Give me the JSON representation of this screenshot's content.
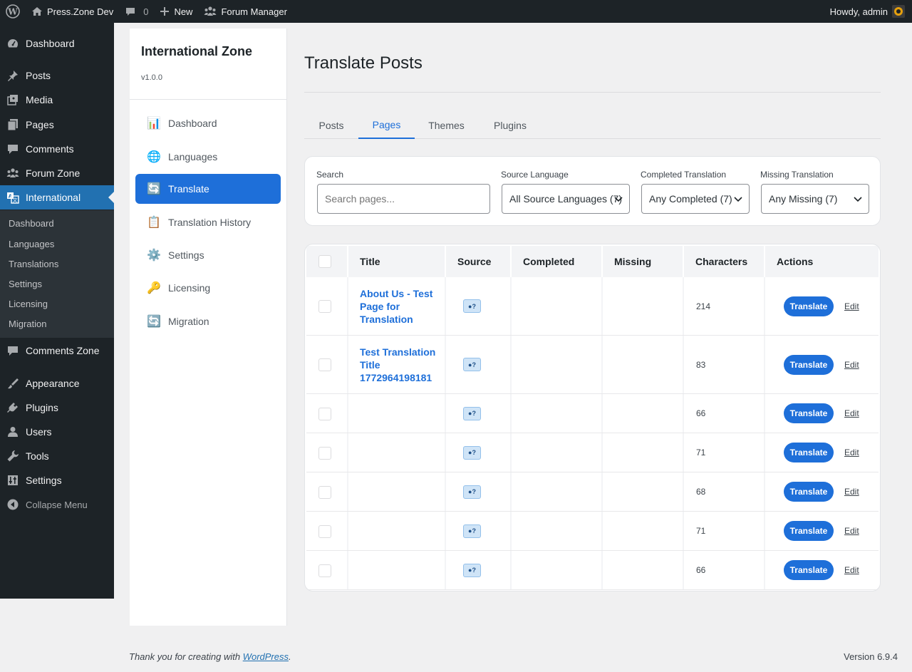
{
  "adminbar": {
    "site_name": "Press.Zone Dev",
    "comments_count": "0",
    "new_label": "New",
    "forum_label": "Forum Manager",
    "howdy": "Howdy, admin"
  },
  "menu": {
    "items": [
      "Dashboard",
      "Posts",
      "Media",
      "Pages",
      "Comments",
      "Forum Zone",
      "International",
      "Comments Zone",
      "Appearance",
      "Plugins",
      "Users",
      "Tools",
      "Settings",
      "Collapse Menu"
    ],
    "submenu": [
      "Dashboard",
      "Languages",
      "Translations",
      "Settings",
      "Licensing",
      "Migration"
    ]
  },
  "plugin": {
    "name": "International Zone",
    "version": "v1.0.0",
    "nav": [
      {
        "icon": "📊",
        "label": "Dashboard"
      },
      {
        "icon": "🌐",
        "label": "Languages"
      },
      {
        "icon": "🔄",
        "label": "Translate"
      },
      {
        "icon": "📋",
        "label": "Translation History"
      },
      {
        "icon": "⚙️",
        "label": "Settings"
      },
      {
        "icon": "🔑",
        "label": "Licensing"
      },
      {
        "icon": "🔄",
        "label": "Migration"
      }
    ]
  },
  "main": {
    "title": "Translate Posts",
    "tabs": [
      "Posts",
      "Pages",
      "Themes",
      "Plugins"
    ],
    "active_tab": "Pages",
    "filters": {
      "search_label": "Search",
      "search_placeholder": "Search pages...",
      "source_label": "Source Language",
      "source_value": "All Source Languages (7)",
      "completed_label": "Completed Translation",
      "completed_value": "Any Completed (7)",
      "missing_label": "Missing Translation",
      "missing_value": "Any Missing (7)"
    },
    "table": {
      "columns": [
        "Title",
        "Source",
        "Completed",
        "Missing",
        "Characters",
        "Actions"
      ],
      "source_badge": "●?",
      "translate_label": "Translate",
      "edit_label": "Edit",
      "rows": [
        {
          "title": "About Us - Test Page for Translation",
          "completed": "",
          "missing": "",
          "characters": "214"
        },
        {
          "title": "Test Translation Title 1772964198181",
          "completed": "",
          "missing": "",
          "characters": "83"
        },
        {
          "title": "",
          "completed": "",
          "missing": "",
          "characters": "66"
        },
        {
          "title": "",
          "completed": "",
          "missing": "",
          "characters": "71"
        },
        {
          "title": "",
          "completed": "",
          "missing": "",
          "characters": "68"
        },
        {
          "title": "",
          "completed": "",
          "missing": "",
          "characters": "71"
        },
        {
          "title": "",
          "completed": "",
          "missing": "",
          "characters": "66"
        }
      ]
    }
  },
  "footer": {
    "thanks_prefix": "Thank you for creating with",
    "wp_link": "WordPress",
    "thanks_suffix": ".",
    "version": "Version 6.9.4"
  }
}
